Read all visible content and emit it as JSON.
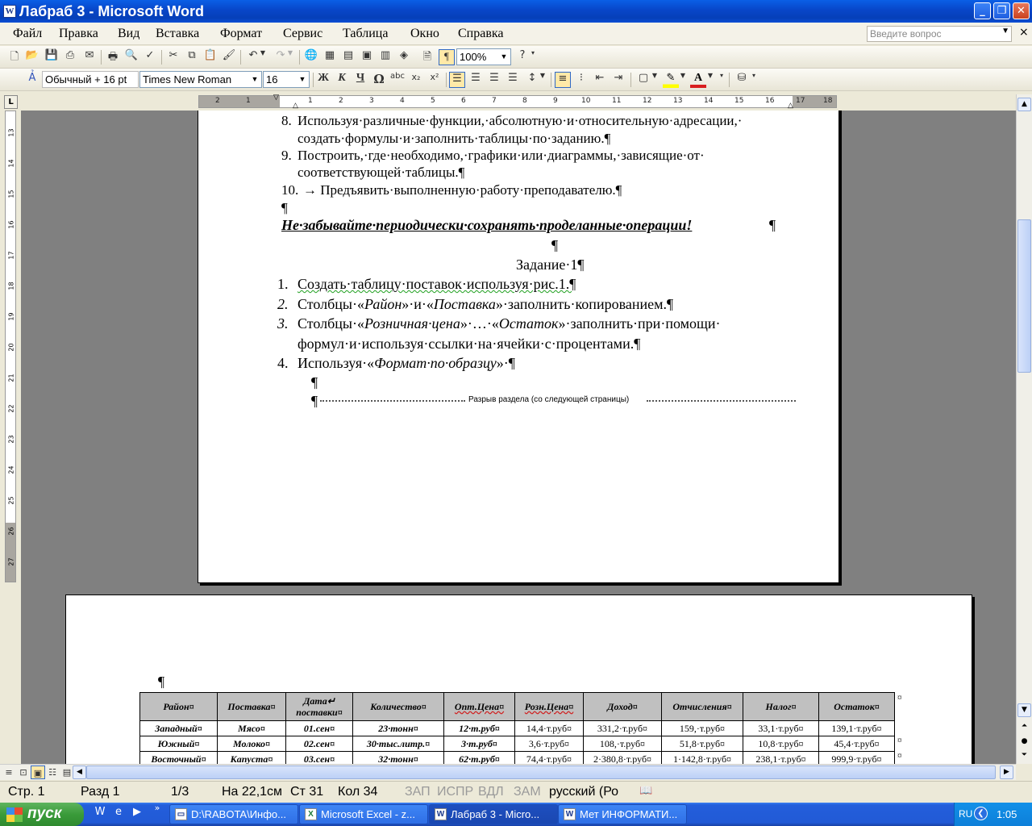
{
  "window": {
    "title": "Лабраб 3 - Microsoft Word",
    "min": "_",
    "max": "❐",
    "close": "✕"
  },
  "menu": {
    "items": [
      "Файл",
      "Правка",
      "Вид",
      "Вставка",
      "Формат",
      "Сервис",
      "Таблица",
      "Окно",
      "Справка"
    ],
    "help_placeholder": "Введите вопрос",
    "close_doc": "×"
  },
  "toolbar_standard": {
    "zoom": "100%",
    "pilcrow": "¶",
    "help_icon": "?"
  },
  "toolbar_format": {
    "style": "Обычный + 16 pt",
    "font": "Times New Roman",
    "size": "16",
    "bold": "Ж",
    "italic": "К",
    "underline": "Ч",
    "omega": "Ω",
    "abc": "abc",
    "sub": "x₂",
    "sup": "x²"
  },
  "ruler": {
    "h_numbers": [
      "2",
      "1",
      "",
      "1",
      "2",
      "3",
      "4",
      "5",
      "6",
      "7",
      "8",
      "9",
      "10",
      "11",
      "12",
      "13",
      "14",
      "15",
      "16",
      "17",
      "18"
    ],
    "v_numbers": [
      "13",
      "14",
      "15",
      "16",
      "17",
      "18",
      "19",
      "20",
      "21",
      "22",
      "23",
      "24",
      "25",
      "26",
      "27"
    ]
  },
  "document": {
    "lines": [
      {
        "num": "8.",
        "text": "Используя·различные·функции,·абсолютную·и·относительную·адресации,·"
      },
      {
        "num": "",
        "text": "создать·формулы·и·заполнить·таблицы·по·заданию.¶"
      },
      {
        "num": "9.",
        "text": "Построить,·где·необходимо,·графики·или·диаграммы,·зависящие·от·"
      },
      {
        "num": "",
        "text": "соответствующей·таблицы.¶"
      },
      {
        "num": "10.",
        "text": "→ Предъявить·выполненную·работу·преподавателю.¶"
      }
    ],
    "empty_para": "¶",
    "warning": "Не·забывайте·периодически·сохранять·проделанные·операции!",
    "warning_mark": "¶",
    "centered_para": "¶",
    "task_title": "Задание·1¶",
    "task_items": [
      {
        "num": "1.",
        "text_a": "Создать·таблицу·поставок·используя·рис.1.¶",
        "text_b": "",
        "text_c": "",
        "text_d": "",
        "text_e": ""
      },
      {
        "num": "2.",
        "text_a": "Столбцы·«",
        "text_b": "Район",
        "text_c": "»·и·«",
        "text_d": "Поставка",
        "text_e": "»·заполнить·копированием.¶"
      },
      {
        "num": "3.",
        "text_a": "Столбцы·«",
        "text_b": "Розничная·цена",
        "text_c": "»·…·«",
        "text_d": "Остаток",
        "text_e": "»·заполнить·при·помощи·"
      },
      {
        "num": "",
        "text_a": "формул·и·используя·ссылки·на·ячейки·с·процентами.¶",
        "text_b": "",
        "text_c": "",
        "text_d": "",
        "text_e": ""
      },
      {
        "num": "4.",
        "text_a": "Используя·«",
        "text_b": "Формат·по·образцу",
        "text_c": "»·¶",
        "text_d": "",
        "text_e": ""
      }
    ],
    "para_a": "¶",
    "section_break": "Разрыв раздела (со следующей страницы)",
    "para_b": "¶",
    "page2_para": "¶"
  },
  "table": {
    "headers": [
      "Район¤",
      "Поставка¤",
      "Дата↵ поставки¤",
      "Количество¤",
      "Опт.Цена¤",
      "Розн.Цена¤",
      "Доход¤",
      "Отчисления¤",
      "Налог¤",
      "Остаток¤"
    ],
    "rows": [
      [
        "Западный¤",
        "Мясо¤",
        "01.сен¤",
        "23·тонн¤",
        "12·т.руб¤",
        "14,4·т.руб¤",
        "331,2·т.руб¤",
        "159,·т.руб¤",
        "33,1·т.руб¤",
        "139,1·т.руб¤"
      ],
      [
        "Южный¤",
        "Молоко¤",
        "02.сен¤",
        "30·тыс.литр.¤",
        "3·т.руб¤",
        "3,6·т.руб¤",
        "108,·т.руб¤",
        "51,8·т.руб¤",
        "10,8·т.руб¤",
        "45,4·т.руб¤"
      ],
      [
        "Восточный¤",
        "Капуста¤",
        "03.сен¤",
        "32·тонн¤",
        "62·т.руб¤",
        "74,4·т.руб¤",
        "2·380,8·т.руб¤",
        "1·142,8·т.руб¤",
        "238,1·т.руб¤",
        "999,9·т.руб¤"
      ]
    ],
    "row_end": "¤"
  },
  "status": {
    "page": "Стр. 1",
    "section": "Разд 1",
    "pages": "1/3",
    "at": "На 22,1см",
    "line": "Ст 31",
    "col": "Кол 34",
    "rec": "ЗАП",
    "trk": "ИСПР",
    "ext": "ВДЛ",
    "ovr": "ЗАМ",
    "lang": "русский (Ро"
  },
  "taskbar": {
    "start": "пуск",
    "tasks": [
      "D:\\RABOTA\\Инфо...",
      "Microsoft Excel - z...",
      "Лабраб 3 - Micro...",
      "Мет ИНФОРМАТИ..."
    ],
    "lang": "RU",
    "clock": "1:05"
  }
}
